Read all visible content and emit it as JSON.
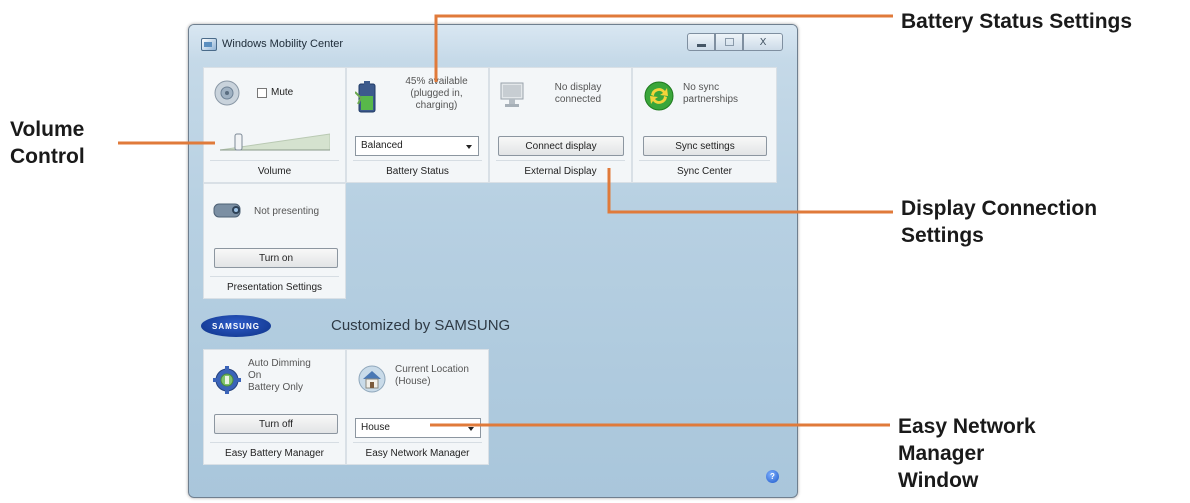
{
  "window": {
    "title": "Windows Mobility Center",
    "controls": {
      "close": "X"
    }
  },
  "tiles": {
    "volume": {
      "mute_label": "Mute",
      "label": "Volume",
      "level_percent": 15
    },
    "battery": {
      "status_text": "45% available (plugged in, charging)",
      "plan": "Balanced",
      "label": "Battery Status"
    },
    "display": {
      "status_text": "No display connected",
      "button": "Connect display",
      "label": "External Display"
    },
    "sync": {
      "status_text": "No sync partnerships",
      "button": "Sync settings",
      "label": "Sync Center"
    },
    "presentation": {
      "status_text": "Not presenting",
      "button": "Turn on",
      "label": "Presentation Settings"
    },
    "dimming": {
      "status_text_1": "Auto Dimming",
      "status_text_2": "On",
      "status_text_3": "Battery Only",
      "button": "Turn off",
      "label": "Easy Battery Manager"
    },
    "network": {
      "status_text_1": "Current Location",
      "status_text_2": "(House)",
      "location": "House",
      "label": "Easy Network Manager"
    }
  },
  "oem": {
    "logo_text": "SAMSUNG",
    "customized_text": "Customized by SAMSUNG"
  },
  "annotations": {
    "volume_1": "Volume",
    "volume_2": "Control",
    "battery": "Battery Status Settings",
    "display_1": "Display Connection",
    "display_2": "Settings",
    "network_1": "Easy Network",
    "network_2": "Manager",
    "network_3": "Window"
  },
  "colors": {
    "leader": "#e07a3a",
    "window_bg": "#b7d0e2",
    "tile_bg": "#f3f6f8"
  }
}
